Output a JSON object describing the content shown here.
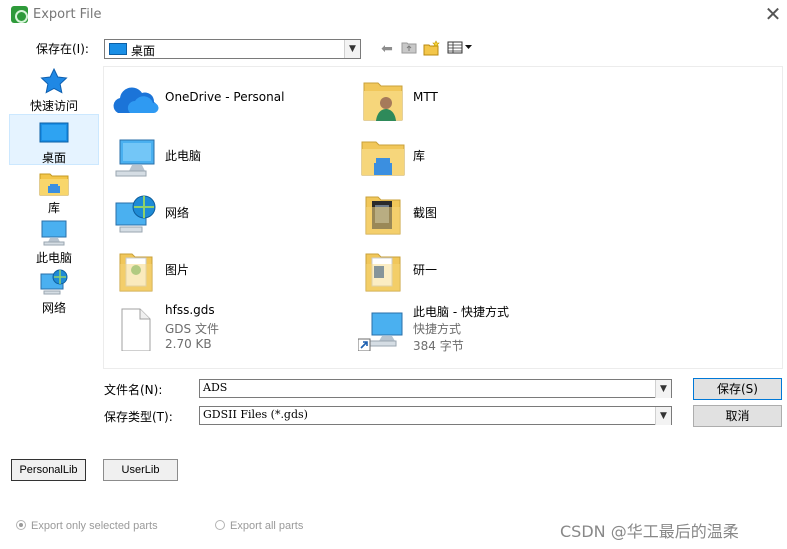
{
  "window": {
    "title": "Export File"
  },
  "toolbar": {
    "save_in_label": "保存在(I):",
    "save_in_value": "桌面"
  },
  "places": [
    {
      "label": "快速访问",
      "icon": "star-icon"
    },
    {
      "label": "桌面",
      "icon": "desktop-icon",
      "selected": true
    },
    {
      "label": "库",
      "icon": "library-icon"
    },
    {
      "label": "此电脑",
      "icon": "computer-icon"
    },
    {
      "label": "网络",
      "icon": "network-icon"
    }
  ],
  "files": [
    {
      "name": "OneDrive - Personal",
      "icon": "onedrive-cloud-icon"
    },
    {
      "name": "MTT",
      "icon": "user-folder-icon"
    },
    {
      "name": "此电脑",
      "icon": "computer-icon"
    },
    {
      "name": "库",
      "icon": "library-icon"
    },
    {
      "name": "网络",
      "icon": "network-icon"
    },
    {
      "name": "截图",
      "icon": "folder-icon"
    },
    {
      "name": "图片",
      "icon": "folder-icon"
    },
    {
      "name": "研一",
      "icon": "folder-icon"
    },
    {
      "name": "hfss.gds",
      "type": "GDS 文件",
      "size": "2.70 KB",
      "icon": "file-icon"
    },
    {
      "name": "此电脑 - 快捷方式",
      "type": "快捷方式",
      "size": "384 字节",
      "icon": "shortcut-icon"
    }
  ],
  "form": {
    "filename_label": "文件名(N):",
    "filename_value": "ADS",
    "filetype_label": "保存类型(T):",
    "filetype_value": "GDSII Files (*.gds)",
    "save_button": "保存(S)",
    "cancel_button": "取消"
  },
  "lib_buttons": {
    "personal": "PersonalLib",
    "user": "UserLib"
  },
  "options": {
    "selected_parts": "Export only selected parts",
    "all_parts": "Export all parts"
  },
  "watermark": "CSDN @华工最后的温柔"
}
